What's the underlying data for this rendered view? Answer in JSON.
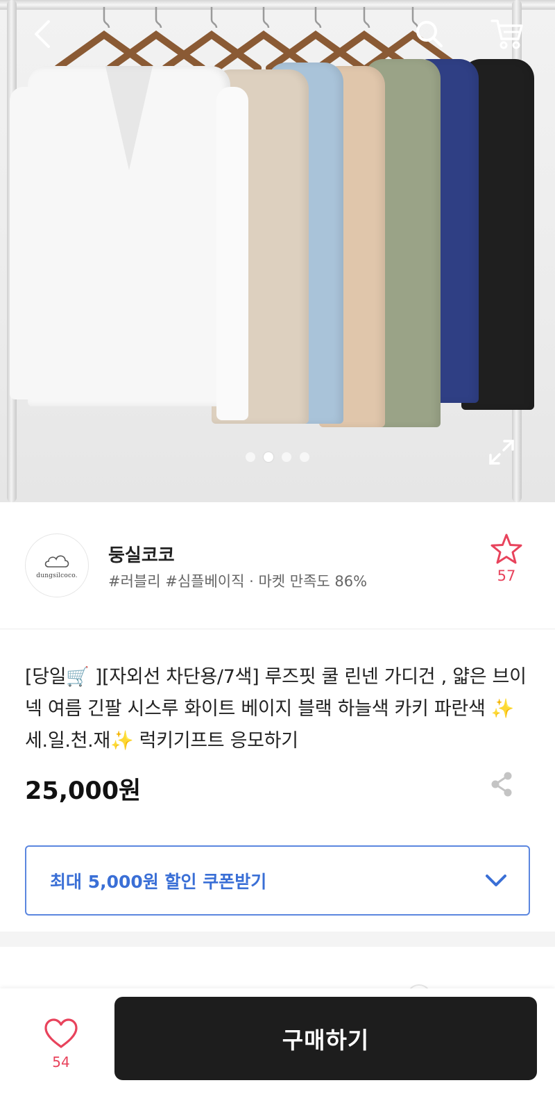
{
  "header": {
    "back_icon": "chevron-left-icon",
    "search_icon": "search-icon",
    "cart_icon": "cart-icon",
    "expand_icon": "expand-icon"
  },
  "gallery": {
    "slide_count": 4,
    "active_index": 1,
    "garment_colors": [
      "#f7f7f7",
      "#ddd0bf",
      "#a9c3d9",
      "#e0c6ab",
      "#9aa387",
      "#2f3f84",
      "#1f1f1f"
    ]
  },
  "seller": {
    "logo_text": "dungsilcoco.",
    "name": "둥실코코",
    "tags": "#러블리 #심플베이직 · 마켓 만족도 86%",
    "favorite_count": "57"
  },
  "product": {
    "title": "[당일🛒 ][자외선 차단용/7색] 루즈핏 쿨 린넨 가디건 , 얇은 브이넥 여름 긴팔 시스루 화이트 베이지 블랙 하늘색 카키 파란색 ✨ 세.일.천.재✨  럭키기프트 응모하기",
    "price": "25,000원",
    "coupon_label": "최대 5,000원 할인 쿠폰받기"
  },
  "bottom_bar": {
    "like_count": "54",
    "buy_label": "구매하기"
  },
  "colors": {
    "accent_pink": "#e8435c",
    "coupon_blue": "#3a6fd6",
    "buy_button": "#1d1d1d"
  }
}
